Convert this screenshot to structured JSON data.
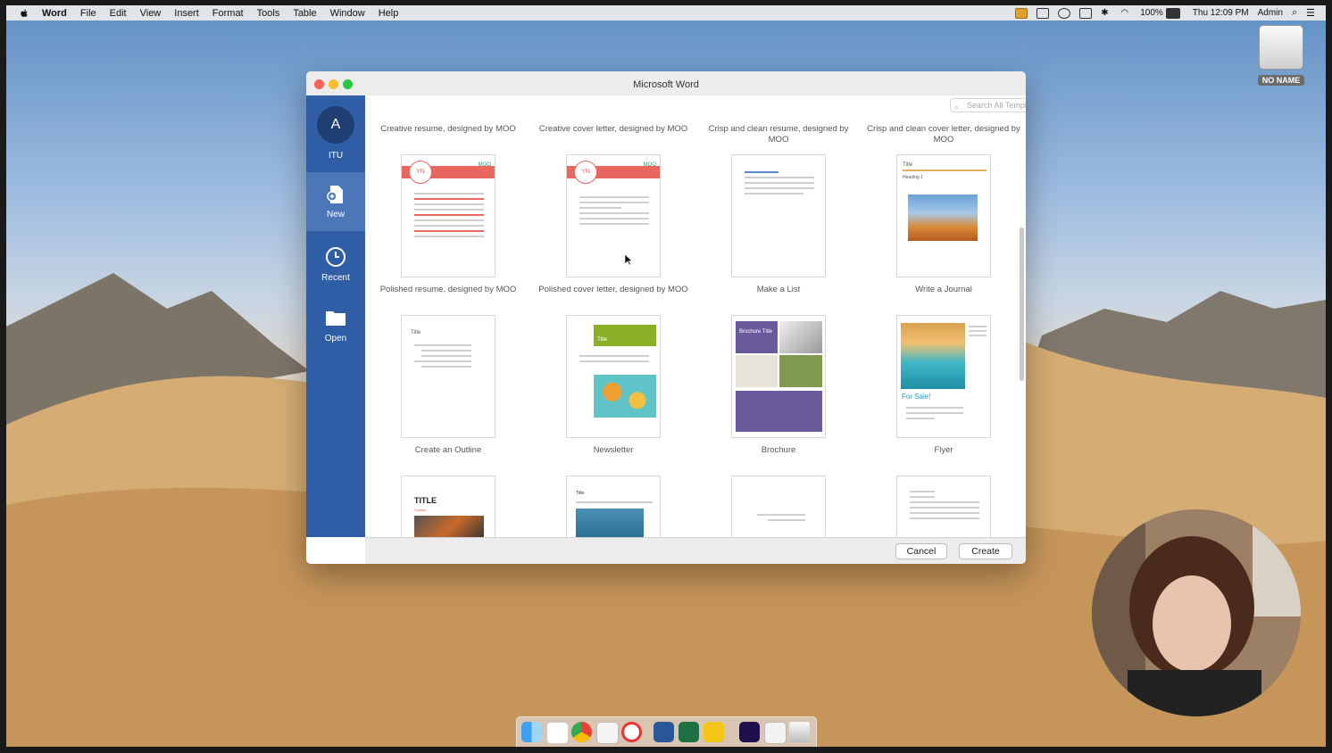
{
  "menubar": {
    "app": "Word",
    "items": [
      "File",
      "Edit",
      "View",
      "Insert",
      "Format",
      "Tools",
      "Table",
      "Window",
      "Help"
    ],
    "battery": "100%",
    "clock": "Thu 12:09 PM",
    "user": "Admin"
  },
  "desktop": {
    "drive_label": "NO NAME"
  },
  "window": {
    "title": "Microsoft Word",
    "search_placeholder": "Search All Templates",
    "sidebar": {
      "account_initial": "A",
      "account_name": "ITU",
      "items": [
        {
          "label": "New",
          "icon": "new-document-icon",
          "active": true
        },
        {
          "label": "Recent",
          "icon": "clock-icon",
          "active": false
        },
        {
          "label": "Open",
          "icon": "folder-icon",
          "active": false
        }
      ]
    },
    "top_captions": [
      "Creative resume, designed by MOO",
      "Creative cover letter, designed by MOO",
      "Crisp and clean resume, designed by MOO",
      "Crisp and clean cover letter, designed by MOO"
    ],
    "row1": [
      {
        "caption": "Polished resume, designed by MOO",
        "monogram": "YN",
        "brand": "MOO"
      },
      {
        "caption": "Polished cover letter, designed by MOO",
        "monogram": "YN",
        "brand": "MOO"
      },
      {
        "caption": "Make a List"
      },
      {
        "caption": "Write a Journal",
        "thumb_title": "Title",
        "thumb_heading": "Heading 1"
      }
    ],
    "row2": [
      {
        "caption": "Create an Outline",
        "thumb_title": "Title"
      },
      {
        "caption": "Newsletter",
        "thumb_title": "Title"
      },
      {
        "caption": "Brochure",
        "thumb_title": "Brochure Title"
      },
      {
        "caption": "Flyer",
        "thumb_title": "For Sale!"
      }
    ],
    "row3": [
      {
        "thumb_title": "TITLE",
        "thumb_subtitle": "Subtitle"
      },
      {
        "thumb_title": "Title"
      },
      {},
      {}
    ],
    "buttons": {
      "cancel": "Cancel",
      "create": "Create"
    }
  },
  "colors": {
    "sidebar": "#2f5ea6",
    "accent_red": "#e8675f",
    "brochure_purple": "#6a5a9c",
    "newsletter_green": "#8ab026"
  }
}
